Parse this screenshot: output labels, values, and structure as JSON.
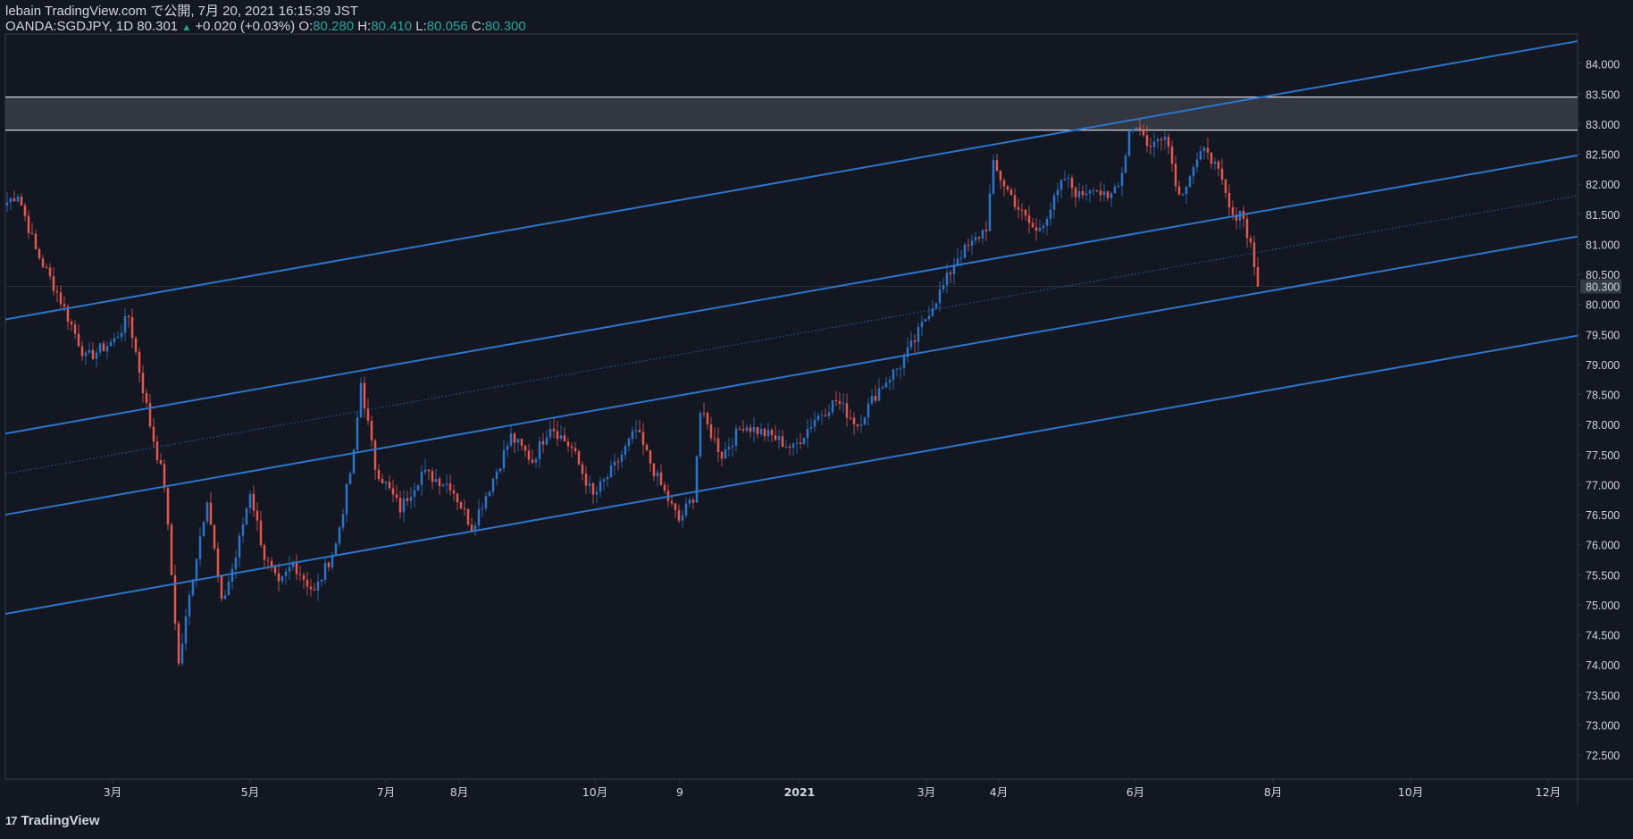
{
  "header": {
    "line1": "lebain TradingView.com で公開, 7月 20, 2021 16:15:39 JST",
    "symbol": "OANDA:SGDJPY, 1D 80.301",
    "change": "+0.020 (+0.03%)",
    "o_label": "O:",
    "o_val": "80.280",
    "h_label": "H:",
    "h_val": "80.410",
    "l_label": "L:",
    "l_val": "80.056",
    "c_label": "C:",
    "c_val": "80.300"
  },
  "footer": {
    "logo_icon": "17",
    "logo_text": "TradingView"
  },
  "colors": {
    "bg": "#131722",
    "up": "#2e74c9",
    "down": "#e5584f",
    "channel": "#2e74c9",
    "band": "#3a3d47",
    "text": "#d1d4dc"
  },
  "chart_data": {
    "type": "candlestick",
    "symbol": "OANDA:SGDJPY",
    "interval": "1D",
    "ylim": [
      72.1,
      84.5
    ],
    "y_ticks": [
      "84.000",
      "83.500",
      "83.000",
      "82.500",
      "82.000",
      "81.500",
      "81.000",
      "80.500",
      "80.000",
      "79.500",
      "79.000",
      "78.500",
      "78.000",
      "77.500",
      "77.000",
      "76.500",
      "76.000",
      "75.500",
      "75.000",
      "74.500",
      "74.000",
      "73.500",
      "73.000",
      "72.500"
    ],
    "last_price": "80.300",
    "x_ticks": [
      "3月",
      "5月",
      "7月",
      "8月",
      "10月",
      "9",
      "2021",
      "3月",
      "4月",
      "6月",
      "8月",
      "10月",
      "12月"
    ],
    "path_keypoints": [
      [
        0,
        81.7
      ],
      [
        3,
        81.85
      ],
      [
        8,
        80.9
      ],
      [
        14,
        80.2
      ],
      [
        22,
        79.1
      ],
      [
        30,
        79.4
      ],
      [
        34,
        79.8
      ],
      [
        40,
        78.0
      ],
      [
        44,
        77.0
      ],
      [
        48,
        74.0
      ],
      [
        52,
        75.5
      ],
      [
        56,
        76.8
      ],
      [
        60,
        75.0
      ],
      [
        64,
        75.8
      ],
      [
        68,
        76.9
      ],
      [
        72,
        75.8
      ],
      [
        76,
        75.3
      ],
      [
        80,
        75.7
      ],
      [
        86,
        75.2
      ],
      [
        92,
        76.0
      ],
      [
        97,
        77.5
      ],
      [
        99,
        78.7
      ],
      [
        103,
        77.3
      ],
      [
        110,
        76.6
      ],
      [
        116,
        77.2
      ],
      [
        124,
        77.0
      ],
      [
        130,
        76.3
      ],
      [
        136,
        77.1
      ],
      [
        141,
        77.8
      ],
      [
        147,
        77.4
      ],
      [
        152,
        78.0
      ],
      [
        158,
        77.6
      ],
      [
        164,
        76.8
      ],
      [
        170,
        77.3
      ],
      [
        176,
        77.9
      ],
      [
        182,
        77.1
      ],
      [
        188,
        76.4
      ],
      [
        192,
        76.8
      ],
      [
        194,
        78.2
      ],
      [
        200,
        77.5
      ],
      [
        206,
        78.0
      ],
      [
        214,
        77.8
      ],
      [
        220,
        77.6
      ],
      [
        226,
        78.1
      ],
      [
        232,
        78.4
      ],
      [
        238,
        78.0
      ],
      [
        244,
        78.6
      ],
      [
        250,
        79.0
      ],
      [
        254,
        79.4
      ],
      [
        258,
        79.9
      ],
      [
        262,
        80.3
      ],
      [
        266,
        80.8
      ],
      [
        270,
        81.0
      ],
      [
        274,
        81.3
      ],
      [
        276,
        82.3
      ],
      [
        280,
        81.9
      ],
      [
        284,
        81.5
      ],
      [
        288,
        81.2
      ],
      [
        292,
        81.6
      ],
      [
        296,
        82.1
      ],
      [
        300,
        81.8
      ],
      [
        304,
        82.0
      ],
      [
        308,
        81.7
      ],
      [
        312,
        82.2
      ],
      [
        314,
        82.9
      ],
      [
        316,
        83.0
      ],
      [
        320,
        82.6
      ],
      [
        324,
        82.9
      ],
      [
        328,
        81.8
      ],
      [
        332,
        82.3
      ],
      [
        336,
        82.6
      ],
      [
        340,
        82.0
      ],
      [
        343,
        81.4
      ],
      [
        345,
        81.6
      ],
      [
        348,
        81.0
      ],
      [
        350,
        80.3
      ]
    ],
    "channel_lines": [
      {
        "x": [
          0,
          440
        ],
        "y": [
          79.75,
          84.38
        ]
      },
      {
        "x": [
          0,
          440
        ],
        "y": [
          77.85,
          82.48
        ]
      },
      {
        "x": [
          0,
          440
        ],
        "y": [
          76.5,
          81.13
        ]
      },
      {
        "x": [
          0,
          440
        ],
        "y": [
          74.85,
          79.48
        ]
      }
    ],
    "mid_dotted_line": {
      "x": [
        0,
        440
      ],
      "y": [
        77.18,
        81.81
      ]
    },
    "resistance_zone": [
      82.9,
      83.45
    ],
    "total_bars": 440,
    "last_bar_index": 350
  }
}
